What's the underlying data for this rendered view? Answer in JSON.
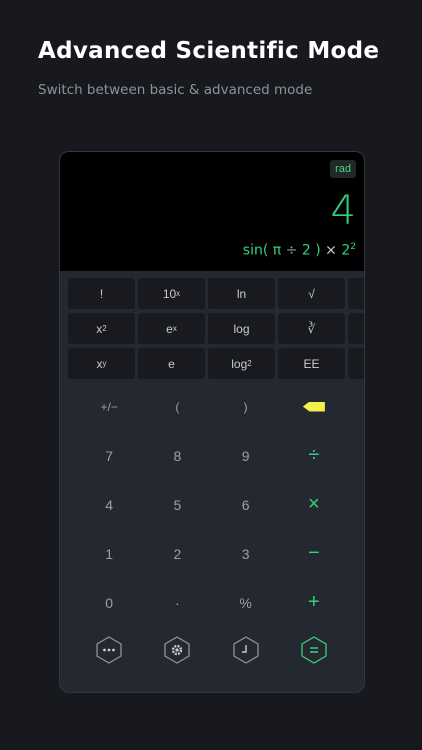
{
  "header": {
    "title": "Advanced Scientific Mode",
    "subtitle": "Switch between basic & advanced mode"
  },
  "display": {
    "angle_mode": "rad",
    "result": "4",
    "expression": {
      "fn": "sin(",
      "pi": "π",
      "div": "÷",
      "two": "2",
      "close": ")",
      "mul": "×",
      "base": "2",
      "exp": "2"
    }
  },
  "scientific": {
    "row1": {
      "fact": "!",
      "ten": "10",
      "ten_sup": "x",
      "ln": "ln",
      "sqrt": "√"
    },
    "row2": {
      "x": "x",
      "x_sup": "2",
      "e": "e",
      "e_sup": "x",
      "log": "log",
      "cbrt": "∛"
    },
    "row3": {
      "x": "x",
      "x_sup": "y",
      "e": "e",
      "log": "log",
      "log_sub": "2",
      "ee": "EE"
    }
  },
  "keypad": {
    "sign": "+/−",
    "lparen": "(",
    "rparen": ")",
    "d7": "7",
    "d8": "8",
    "d9": "9",
    "divide": "÷",
    "d4": "4",
    "d5": "5",
    "d6": "6",
    "multiply": "×",
    "d1": "1",
    "d2": "2",
    "d3": "3",
    "minus": "−",
    "d0": "0",
    "dot": "·",
    "percent": "%",
    "plus": "+"
  },
  "colors": {
    "accent": "#34d17a",
    "delete_key": "#f3f04a",
    "background": "#17191e",
    "panel": "#242830"
  },
  "icons": {
    "menu": "more-dots-icon",
    "settings": "gear-icon",
    "history": "clock-icon",
    "equals": "equals-icon",
    "delete": "backspace-icon"
  }
}
